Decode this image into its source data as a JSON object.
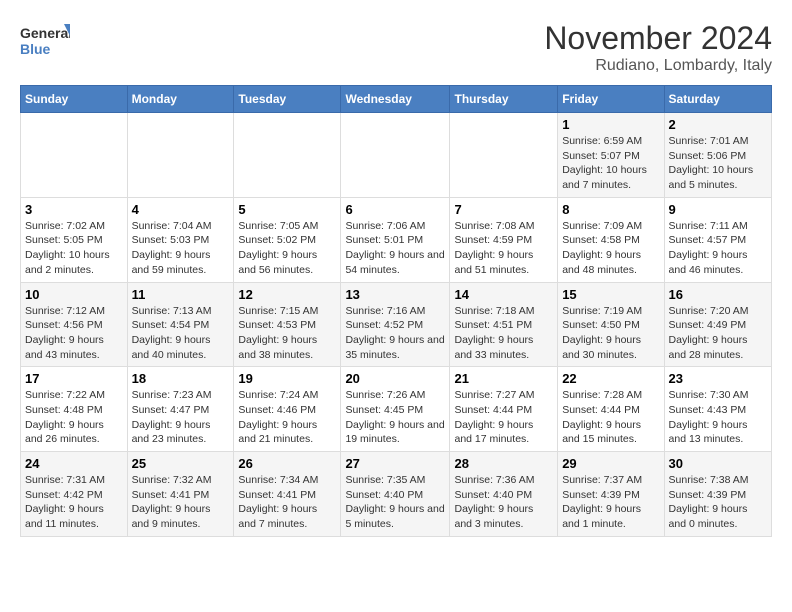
{
  "header": {
    "logo_line1": "General",
    "logo_line2": "Blue",
    "title": "November 2024",
    "location": "Rudiano, Lombardy, Italy"
  },
  "weekdays": [
    "Sunday",
    "Monday",
    "Tuesday",
    "Wednesday",
    "Thursday",
    "Friday",
    "Saturday"
  ],
  "weeks": [
    [
      {
        "day": "",
        "info": ""
      },
      {
        "day": "",
        "info": ""
      },
      {
        "day": "",
        "info": ""
      },
      {
        "day": "",
        "info": ""
      },
      {
        "day": "",
        "info": ""
      },
      {
        "day": "1",
        "info": "Sunrise: 6:59 AM\nSunset: 5:07 PM\nDaylight: 10 hours and 7 minutes."
      },
      {
        "day": "2",
        "info": "Sunrise: 7:01 AM\nSunset: 5:06 PM\nDaylight: 10 hours and 5 minutes."
      }
    ],
    [
      {
        "day": "3",
        "info": "Sunrise: 7:02 AM\nSunset: 5:05 PM\nDaylight: 10 hours and 2 minutes."
      },
      {
        "day": "4",
        "info": "Sunrise: 7:04 AM\nSunset: 5:03 PM\nDaylight: 9 hours and 59 minutes."
      },
      {
        "day": "5",
        "info": "Sunrise: 7:05 AM\nSunset: 5:02 PM\nDaylight: 9 hours and 56 minutes."
      },
      {
        "day": "6",
        "info": "Sunrise: 7:06 AM\nSunset: 5:01 PM\nDaylight: 9 hours and 54 minutes."
      },
      {
        "day": "7",
        "info": "Sunrise: 7:08 AM\nSunset: 4:59 PM\nDaylight: 9 hours and 51 minutes."
      },
      {
        "day": "8",
        "info": "Sunrise: 7:09 AM\nSunset: 4:58 PM\nDaylight: 9 hours and 48 minutes."
      },
      {
        "day": "9",
        "info": "Sunrise: 7:11 AM\nSunset: 4:57 PM\nDaylight: 9 hours and 46 minutes."
      }
    ],
    [
      {
        "day": "10",
        "info": "Sunrise: 7:12 AM\nSunset: 4:56 PM\nDaylight: 9 hours and 43 minutes."
      },
      {
        "day": "11",
        "info": "Sunrise: 7:13 AM\nSunset: 4:54 PM\nDaylight: 9 hours and 40 minutes."
      },
      {
        "day": "12",
        "info": "Sunrise: 7:15 AM\nSunset: 4:53 PM\nDaylight: 9 hours and 38 minutes."
      },
      {
        "day": "13",
        "info": "Sunrise: 7:16 AM\nSunset: 4:52 PM\nDaylight: 9 hours and 35 minutes."
      },
      {
        "day": "14",
        "info": "Sunrise: 7:18 AM\nSunset: 4:51 PM\nDaylight: 9 hours and 33 minutes."
      },
      {
        "day": "15",
        "info": "Sunrise: 7:19 AM\nSunset: 4:50 PM\nDaylight: 9 hours and 30 minutes."
      },
      {
        "day": "16",
        "info": "Sunrise: 7:20 AM\nSunset: 4:49 PM\nDaylight: 9 hours and 28 minutes."
      }
    ],
    [
      {
        "day": "17",
        "info": "Sunrise: 7:22 AM\nSunset: 4:48 PM\nDaylight: 9 hours and 26 minutes."
      },
      {
        "day": "18",
        "info": "Sunrise: 7:23 AM\nSunset: 4:47 PM\nDaylight: 9 hours and 23 minutes."
      },
      {
        "day": "19",
        "info": "Sunrise: 7:24 AM\nSunset: 4:46 PM\nDaylight: 9 hours and 21 minutes."
      },
      {
        "day": "20",
        "info": "Sunrise: 7:26 AM\nSunset: 4:45 PM\nDaylight: 9 hours and 19 minutes."
      },
      {
        "day": "21",
        "info": "Sunrise: 7:27 AM\nSunset: 4:44 PM\nDaylight: 9 hours and 17 minutes."
      },
      {
        "day": "22",
        "info": "Sunrise: 7:28 AM\nSunset: 4:44 PM\nDaylight: 9 hours and 15 minutes."
      },
      {
        "day": "23",
        "info": "Sunrise: 7:30 AM\nSunset: 4:43 PM\nDaylight: 9 hours and 13 minutes."
      }
    ],
    [
      {
        "day": "24",
        "info": "Sunrise: 7:31 AM\nSunset: 4:42 PM\nDaylight: 9 hours and 11 minutes."
      },
      {
        "day": "25",
        "info": "Sunrise: 7:32 AM\nSunset: 4:41 PM\nDaylight: 9 hours and 9 minutes."
      },
      {
        "day": "26",
        "info": "Sunrise: 7:34 AM\nSunset: 4:41 PM\nDaylight: 9 hours and 7 minutes."
      },
      {
        "day": "27",
        "info": "Sunrise: 7:35 AM\nSunset: 4:40 PM\nDaylight: 9 hours and 5 minutes."
      },
      {
        "day": "28",
        "info": "Sunrise: 7:36 AM\nSunset: 4:40 PM\nDaylight: 9 hours and 3 minutes."
      },
      {
        "day": "29",
        "info": "Sunrise: 7:37 AM\nSunset: 4:39 PM\nDaylight: 9 hours and 1 minute."
      },
      {
        "day": "30",
        "info": "Sunrise: 7:38 AM\nSunset: 4:39 PM\nDaylight: 9 hours and 0 minutes."
      }
    ]
  ]
}
